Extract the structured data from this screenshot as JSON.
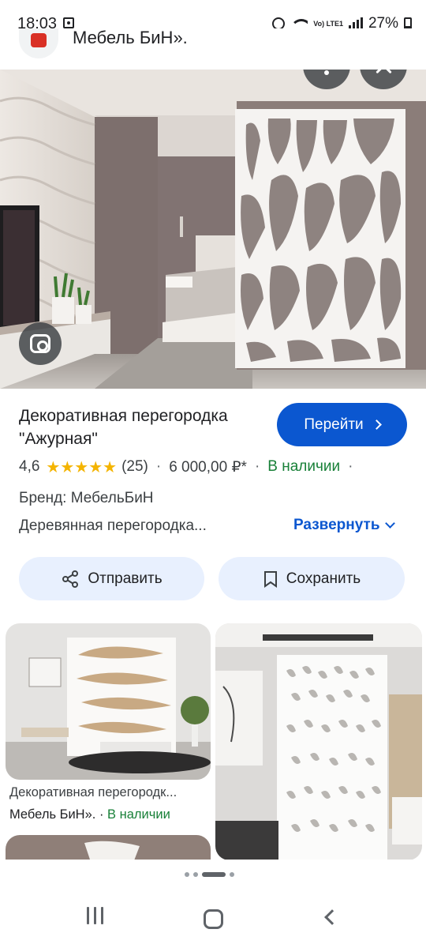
{
  "status_bar": {
    "time": "18:03",
    "lte": "Vo) LTE1",
    "battery": "27%"
  },
  "source": {
    "title": "Мебель БиН»."
  },
  "product": {
    "title": "Декоративная перегородка \"Ажурная\"",
    "goto_label": "Перейти",
    "rating": "4,6",
    "stars": "★★★★★",
    "reviews": "(25)",
    "price": "6 000,00 ₽*",
    "availability": "В наличии",
    "brand": "Бренд: МебельБиН",
    "description": "Деревянная перегородка...",
    "expand_label": "Развернуть"
  },
  "actions": {
    "share_label": "Отправить",
    "save_label": "Сохранить"
  },
  "related": [
    {
      "caption": "Декоративная перегородк...",
      "source": "Мебель БиН».",
      "availability": "В наличии"
    }
  ],
  "icons": {
    "more": "more-vert-icon",
    "close": "close-icon",
    "lens": "lens-icon",
    "share": "share-icon",
    "bookmark": "bookmark-icon"
  },
  "colors": {
    "primary_button": "#0b57d0",
    "chip_bg": "#e8f0fe",
    "star": "#f4b400",
    "in_stock": "#188038"
  }
}
